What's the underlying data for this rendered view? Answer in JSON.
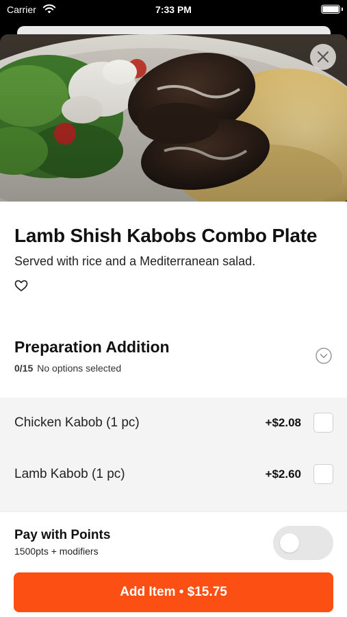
{
  "status_bar": {
    "carrier": "Carrier",
    "time": "7:33 PM"
  },
  "item": {
    "title": "Lamb Shish Kabobs Combo Plate",
    "description": "Served with rice and a Mediterranean salad."
  },
  "section": {
    "title": "Preparation Addition",
    "selected_count": "0/15",
    "selected_text": "No options selected"
  },
  "options": [
    {
      "name": "Chicken Kabob (1 pc)",
      "price": "+$2.08",
      "checked": false
    },
    {
      "name": "Lamb Kabob (1 pc)",
      "price": "+$2.60",
      "checked": false
    }
  ],
  "points": {
    "title": "Pay with Points",
    "subtitle": "1500pts + modifiers",
    "enabled": false
  },
  "add_button": {
    "label": "Add Item • $15.75"
  },
  "colors": {
    "accent": "#fb4f14",
    "options_background": "#f4f4f4"
  },
  "icons": [
    "wifi-icon",
    "battery-icon",
    "close-icon",
    "heart-icon",
    "chevron-down-icon"
  ]
}
